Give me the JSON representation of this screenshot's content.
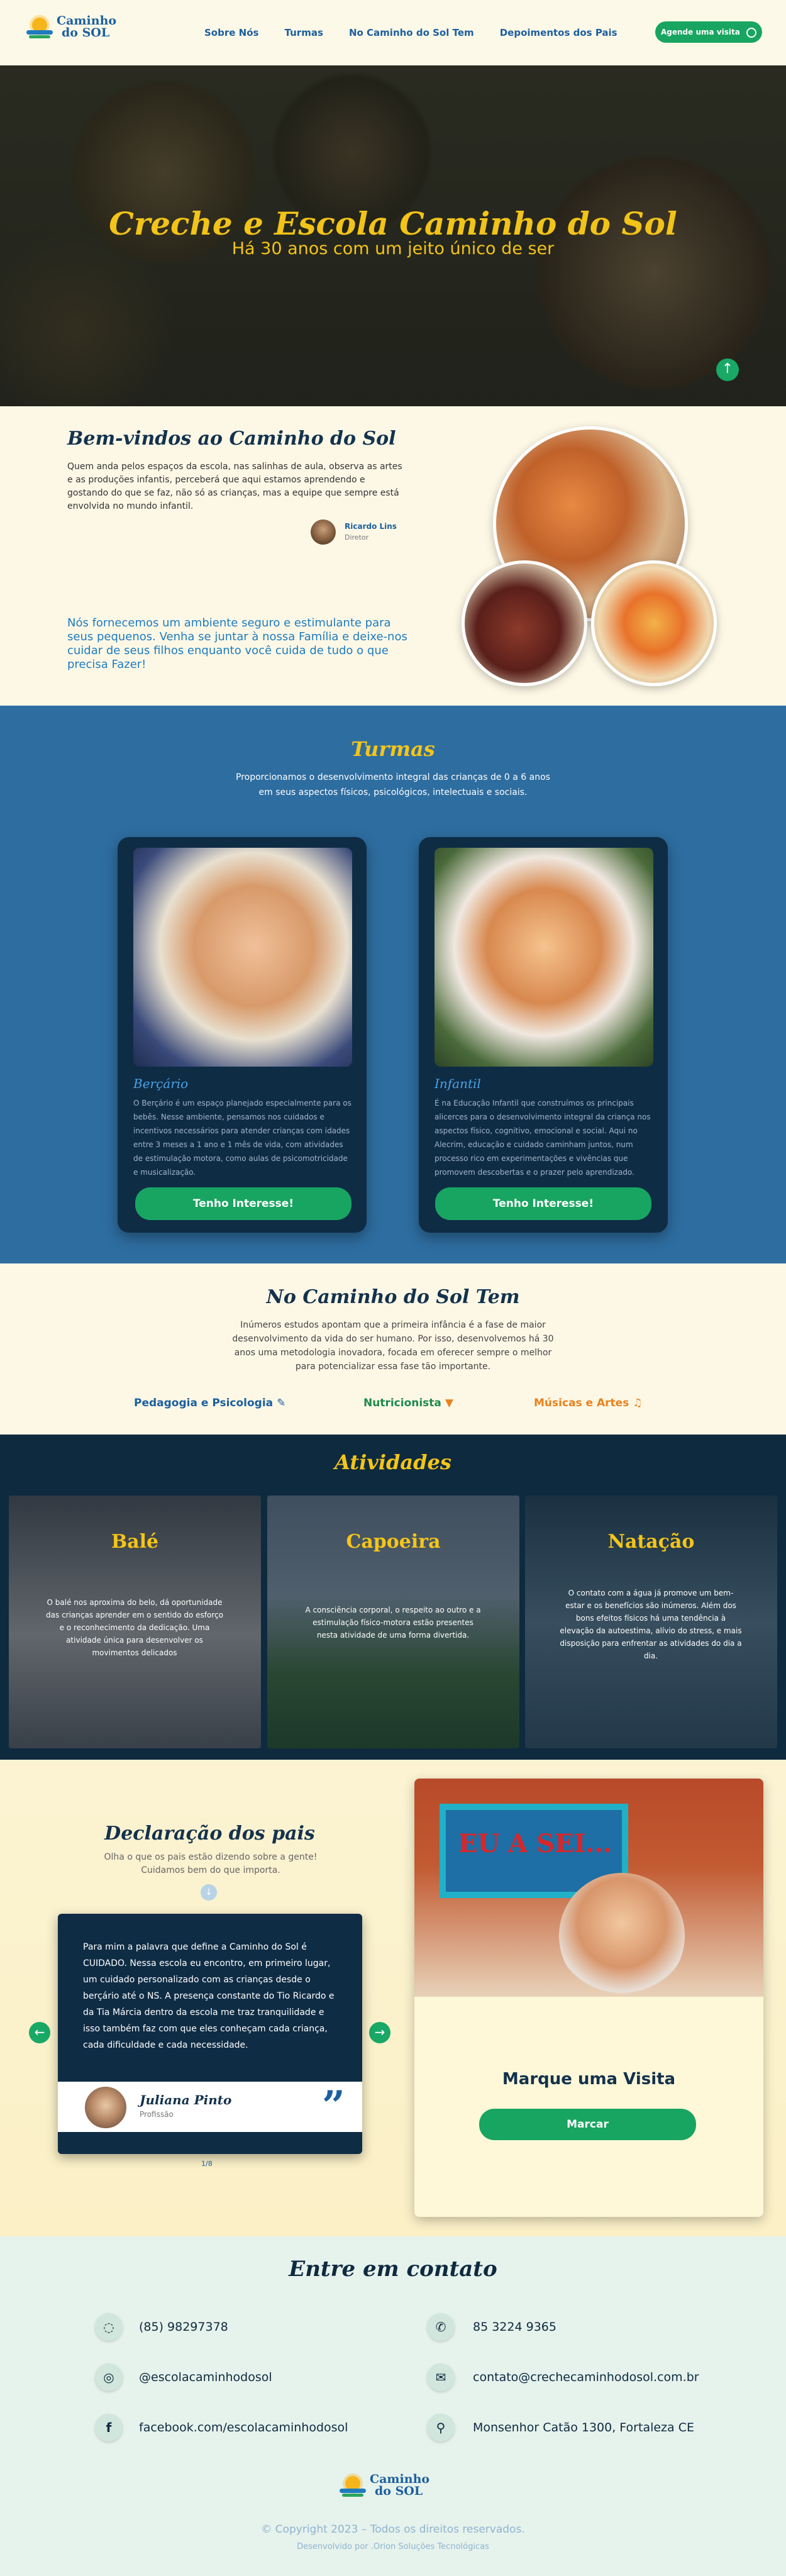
{
  "header": {
    "logo_line1": "Caminho",
    "logo_line2": "do SOL",
    "nav": [
      "Sobre Nós",
      "Turmas",
      "No Caminho do Sol Tem",
      "Depoimentos dos Pais"
    ],
    "cta": "Agende uma visita"
  },
  "hero": {
    "title": "Creche e Escola Caminho do Sol",
    "subtitle": "Há 30 anos com um jeito único de ser"
  },
  "welcome": {
    "title": "Bem-vindos ao Caminho do Sol",
    "paragraph": "Quem anda pelos espaços da escola, nas salinhas de aula, observa as artes e as produções infantis, perceberá que aqui estamos aprendendo e gostando do que se faz, não só as crianças, mas a equipe que sempre está envolvida no mundo infantil.",
    "author_name": "Ricardo Lins",
    "author_role": "Diretor",
    "highlight": "Nós fornecemos um ambiente seguro e estimulante para seus pequenos. Venha se juntar à nossa Família e deixe-nos cuidar de seus filhos enquanto você cuida de tudo o que precisa Fazer!"
  },
  "turmas": {
    "title": "Turmas",
    "subtitle": "Proporcionamos o desenvolvimento integral das crianças de 0 a 6 anos em seus aspectos físicos, psicológicos, intelectuais e sociais.",
    "cards": [
      {
        "title": "Berçário",
        "text": "O Berçário é um espaço planejado especialmente para os bebês. Nesse ambiente, pensamos nos cuidados e incentivos necessários para atender crianças com idades entre 3 meses a 1 ano e 1 mês de vida, com atividades de estimulação motora, como aulas de psicomotricidade e musicalização.",
        "button": "Tenho Interesse!"
      },
      {
        "title": "Infantil",
        "text": "É na Educação Infantil que construímos os principais alicerces para o desenvolvimento integral da criança nos aspectos físico, cognitivo, emocional e social. Aqui no Alecrim, educação e cuidado caminham juntos, num processo rico em experimentações e vivências que promovem descobertas e o prazer pelo aprendizado.",
        "button": "Tenho Interesse!"
      }
    ]
  },
  "caminho": {
    "title": "No Caminho do Sol Tem",
    "text": "Inúmeros estudos apontam que a primeira infância é a fase de maior desenvolvimento da vida do ser humano. Por isso, desenvolvemos há 30 anos uma metodologia inovadora, focada em oferecer sempre o melhor para potencializar essa fase tão importante.",
    "items": [
      {
        "label": "Pedagogia e Psicologia",
        "color": "#1c5f9e"
      },
      {
        "label": "Nutricionista",
        "color": "#1f8a4c"
      },
      {
        "label": "Músicas e Artes",
        "color": "#e8821e"
      }
    ]
  },
  "atividades": {
    "title": "Atividades",
    "items": [
      {
        "title": "Balé",
        "text": "O balé nos aproxima do belo, dá oportunidade das crianças aprender em o sentido do esforço e o reconhecimento da dedicação. Uma atividade única para desenvolver os movimentos delicados"
      },
      {
        "title": "Capoeira",
        "text": "A consciência corporal, o respeito ao outro e a estimulação físico-motora estão presentes nesta atividade de uma forma divertida."
      },
      {
        "title": "Natação",
        "text": "O contato com a água já promove um bem-estar e os benefícios são inúmeros. Além dos bons efeitos físicos há uma tendência à elevação da autoestima, alívio do stress, e mais disposição para enfrentar as atividades do dia a dia."
      }
    ]
  },
  "declaracao": {
    "title": "Declaração dos pais",
    "subtitle": "Olha o que os pais estão dizendo sobre a gente! Cuidamos bem do que importa.",
    "testimonial": "Para mim a palavra que define a Caminho do Sol é CUIDADO. Nessa escola eu encontro, em primeiro lugar, um cuidado personalizado com as crianças desde o berçário até o NS. A presença constante do Tio Ricardo e da Tia Márcia dentro da escola me traz tranquilidade e isso também faz com que eles conheçam cada criança, cada dificuldade e cada necessidade.",
    "name": "Juliana Pinto",
    "role": "Profissão",
    "pager": "1/8",
    "visit_banner": "EU A SEI...",
    "visit_title": "Marque uma Visita",
    "visit_button": "Marcar"
  },
  "contato": {
    "title": "Entre em contato",
    "left": [
      {
        "icon": "whatsapp-icon",
        "text": "(85) 98297378"
      },
      {
        "icon": "instagram-icon",
        "text": "@escolacaminhodosol"
      },
      {
        "icon": "facebook-icon",
        "text": "facebook.com/escolacaminhodosol"
      }
    ],
    "right": [
      {
        "icon": "phone-icon",
        "text": "85 3224 9365"
      },
      {
        "icon": "mail-icon",
        "text": "contato@crechecaminhodosol.com.br"
      },
      {
        "icon": "map-pin-icon",
        "text": "Monsenhor Catão 1300, Fortaleza CE"
      }
    ],
    "copyright": "© Copyright 2023 – Todos os direitos reservados.",
    "credit": "Desenvolvido por .Orion Soluções Tecnológicas"
  }
}
